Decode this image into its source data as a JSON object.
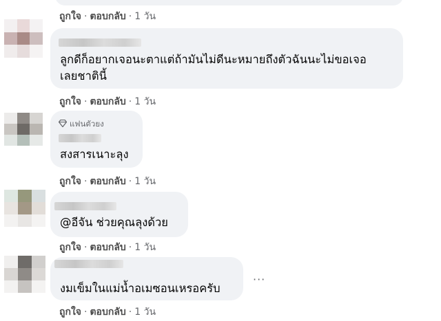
{
  "actions": {
    "like_label": "ถูกใจ",
    "separator": "·",
    "reply_label": "ตอบกลับ",
    "time_label": "1 วัน"
  },
  "comments": [
    {
      "text_lines": [
        "ลูกดีก็อยากเจอนะตาแต่ถ้ามันไม่ดีนะหมายถึงตัวฉันนะไม่ขอเจอ",
        "เลยชาตินี้"
      ]
    },
    {
      "badge": "แฟนตัวยง",
      "text_lines": [
        "สงสารเนาะลุง"
      ]
    },
    {
      "text_lines": [
        "@อีจัน ช่วยคุณลุงด้วย"
      ]
    },
    {
      "text_lines": [
        "งมเข็มในแม่น้ำอเมซอนเหรอครับ"
      ],
      "more_label": "···"
    }
  ],
  "colors": {
    "bubble_bg": "#f0f2f5",
    "meta_text": "#65676b",
    "main_text": "#050505"
  }
}
